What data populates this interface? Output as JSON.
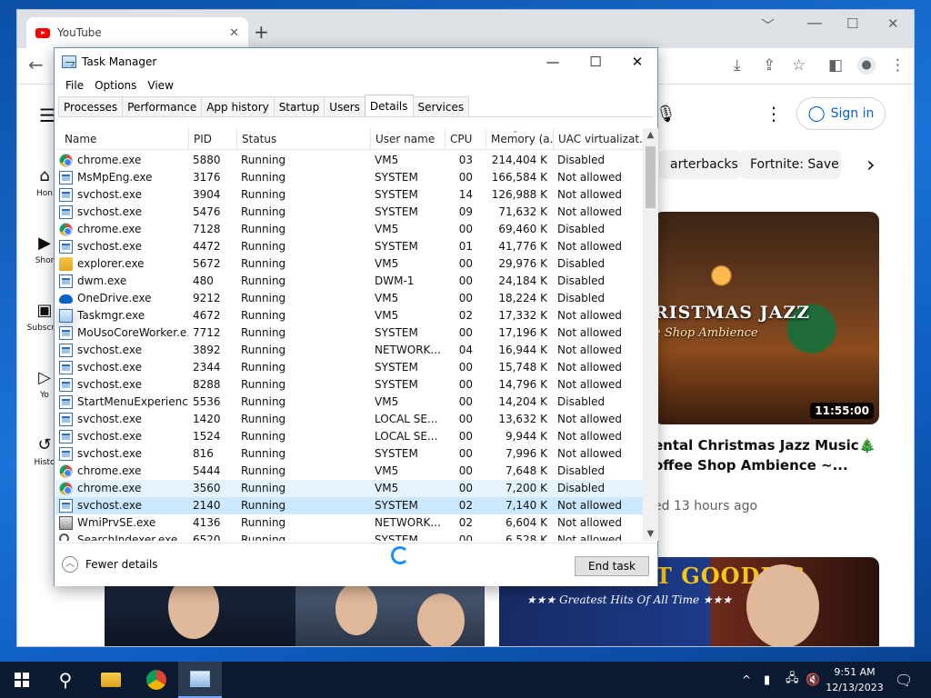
{
  "browser": {
    "tab_title": "YouTube",
    "tab_close": "✕",
    "new_tab": "+",
    "win_min": "﹀",
    "win_restore": "☐",
    "win_close": "✕",
    "back": "←"
  },
  "youtube": {
    "sign_in": "Sign in",
    "chips": [
      "arterbacks",
      "Fortnite: Save th"
    ],
    "chip_next": "›",
    "sidebar": [
      {
        "icon": "home-icon",
        "label": "Hon"
      },
      {
        "icon": "shorts-icon",
        "label": "Shor"
      },
      {
        "icon": "subscriptions-icon",
        "label": "Subscrip"
      },
      {
        "icon": "you-icon",
        "label": "Yo"
      },
      {
        "icon": "history-icon",
        "label": "Histo"
      }
    ],
    "video": {
      "thumb_title": "RISTMAS JAZZ",
      "thumb_sub": "e Shop Ambience",
      "duration": "11:55:00",
      "title_line1": "ental Christmas Jazz Music🎄",
      "title_line2": "offee Shop Ambience ~...",
      "meta": "ed 13 hours ago"
    },
    "bottom_thumb": {
      "big": "OLDIES BUT GOODIES",
      "small": "★★★ Greatest Hits Of All Time ★★★"
    }
  },
  "task_manager": {
    "title": "Task Manager",
    "min": "—",
    "max": "☐",
    "close": "✕",
    "menu": [
      "File",
      "Options",
      "View"
    ],
    "tabs": [
      "Processes",
      "Performance",
      "App history",
      "Startup",
      "Users",
      "Details",
      "Services"
    ],
    "active_tab": "Details",
    "columns": [
      "Name",
      "PID",
      "Status",
      "User name",
      "CPU",
      "Memory (a...",
      "UAC virtualizat..."
    ],
    "rows": [
      {
        "icon": "chrome",
        "name": "chrome.exe",
        "pid": "5880",
        "status": "Running",
        "user": "VM5",
        "cpu": "03",
        "mem": "214,404 K",
        "uac": "Disabled"
      },
      {
        "icon": "svc",
        "name": "MsMpEng.exe",
        "pid": "3176",
        "status": "Running",
        "user": "SYSTEM",
        "cpu": "00",
        "mem": "166,584 K",
        "uac": "Not allowed"
      },
      {
        "icon": "svc",
        "name": "svchost.exe",
        "pid": "3904",
        "status": "Running",
        "user": "SYSTEM",
        "cpu": "14",
        "mem": "126,988 K",
        "uac": "Not allowed"
      },
      {
        "icon": "svc",
        "name": "svchost.exe",
        "pid": "5476",
        "status": "Running",
        "user": "SYSTEM",
        "cpu": "09",
        "mem": "71,632 K",
        "uac": "Not allowed"
      },
      {
        "icon": "chrome",
        "name": "chrome.exe",
        "pid": "7128",
        "status": "Running",
        "user": "VM5",
        "cpu": "00",
        "mem": "69,460 K",
        "uac": "Disabled"
      },
      {
        "icon": "svc",
        "name": "svchost.exe",
        "pid": "4472",
        "status": "Running",
        "user": "SYSTEM",
        "cpu": "01",
        "mem": "41,776 K",
        "uac": "Not allowed"
      },
      {
        "icon": "folder",
        "name": "explorer.exe",
        "pid": "5672",
        "status": "Running",
        "user": "VM5",
        "cpu": "00",
        "mem": "29,976 K",
        "uac": "Disabled"
      },
      {
        "icon": "svc",
        "name": "dwm.exe",
        "pid": "480",
        "status": "Running",
        "user": "DWM-1",
        "cpu": "00",
        "mem": "24,184 K",
        "uac": "Disabled"
      },
      {
        "icon": "cloud",
        "name": "OneDrive.exe",
        "pid": "9212",
        "status": "Running",
        "user": "VM5",
        "cpu": "00",
        "mem": "18,224 K",
        "uac": "Disabled"
      },
      {
        "icon": "tm",
        "name": "Taskmgr.exe",
        "pid": "4672",
        "status": "Running",
        "user": "VM5",
        "cpu": "02",
        "mem": "17,332 K",
        "uac": "Not allowed"
      },
      {
        "icon": "svc",
        "name": "MoUsoCoreWorker.e...",
        "pid": "7712",
        "status": "Running",
        "user": "SYSTEM",
        "cpu": "00",
        "mem": "17,196 K",
        "uac": "Not allowed"
      },
      {
        "icon": "svc",
        "name": "svchost.exe",
        "pid": "3892",
        "status": "Running",
        "user": "NETWORK...",
        "cpu": "04",
        "mem": "16,944 K",
        "uac": "Not allowed"
      },
      {
        "icon": "svc",
        "name": "svchost.exe",
        "pid": "2344",
        "status": "Running",
        "user": "SYSTEM",
        "cpu": "00",
        "mem": "15,748 K",
        "uac": "Not allowed"
      },
      {
        "icon": "svc",
        "name": "svchost.exe",
        "pid": "8288",
        "status": "Running",
        "user": "SYSTEM",
        "cpu": "00",
        "mem": "14,796 K",
        "uac": "Not allowed"
      },
      {
        "icon": "svc",
        "name": "StartMenuExperienc...",
        "pid": "5536",
        "status": "Running",
        "user": "VM5",
        "cpu": "00",
        "mem": "14,204 K",
        "uac": "Disabled"
      },
      {
        "icon": "svc",
        "name": "svchost.exe",
        "pid": "1420",
        "status": "Running",
        "user": "LOCAL SE...",
        "cpu": "00",
        "mem": "13,632 K",
        "uac": "Not allowed"
      },
      {
        "icon": "svc",
        "name": "svchost.exe",
        "pid": "1524",
        "status": "Running",
        "user": "LOCAL SE...",
        "cpu": "00",
        "mem": "9,944 K",
        "uac": "Not allowed"
      },
      {
        "icon": "svc",
        "name": "svchost.exe",
        "pid": "816",
        "status": "Running",
        "user": "SYSTEM",
        "cpu": "00",
        "mem": "7,996 K",
        "uac": "Not allowed"
      },
      {
        "icon": "chrome",
        "name": "chrome.exe",
        "pid": "5444",
        "status": "Running",
        "user": "VM5",
        "cpu": "00",
        "mem": "7,648 K",
        "uac": "Disabled"
      },
      {
        "icon": "chrome",
        "name": "chrome.exe",
        "pid": "3560",
        "status": "Running",
        "user": "VM5",
        "cpu": "00",
        "mem": "7,200 K",
        "uac": "Disabled",
        "state": "hover"
      },
      {
        "icon": "svc",
        "name": "svchost.exe",
        "pid": "2140",
        "status": "Running",
        "user": "SYSTEM",
        "cpu": "02",
        "mem": "7,140 K",
        "uac": "Not allowed",
        "state": "selected"
      },
      {
        "icon": "wmi",
        "name": "WmiPrvSE.exe",
        "pid": "4136",
        "status": "Running",
        "user": "NETWORK...",
        "cpu": "02",
        "mem": "6,604 K",
        "uac": "Not allowed"
      },
      {
        "icon": "search",
        "name": "SearchIndexer.exe",
        "pid": "6520",
        "status": "Running",
        "user": "SYSTEM",
        "cpu": "00",
        "mem": "6,528 K",
        "uac": "Not allowed"
      }
    ],
    "fewer_details": "Fewer details",
    "end_task": "End task"
  },
  "taskbar": {
    "time": "9:51 AM",
    "date": "12/13/2023",
    "tray_chevron": "^"
  },
  "colors": {
    "accent": "#0078d7",
    "selected_row": "#cce8ff",
    "youtube_red": "#ff0000"
  }
}
